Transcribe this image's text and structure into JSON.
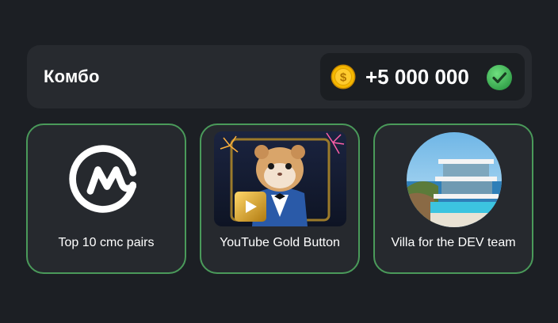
{
  "combo": {
    "title": "Комбо",
    "reward": "+5 000 000",
    "coin_icon": "dollar-coin-icon",
    "status_icon": "checkmark-icon",
    "status_color": "#3fbf5a"
  },
  "cards": [
    {
      "label": "Top 10 cmc pairs",
      "image": "coinmarketcap-logo"
    },
    {
      "label": "YouTube Gold Button",
      "image": "hamster-with-gold-play-button"
    },
    {
      "label": "Villa for the DEV team",
      "image": "modern-seaside-villa"
    }
  ],
  "colors": {
    "background": "#1c1f24",
    "panel": "#272a2f",
    "card_border": "#4a9a5a",
    "coin_gold": "#f5b800"
  }
}
